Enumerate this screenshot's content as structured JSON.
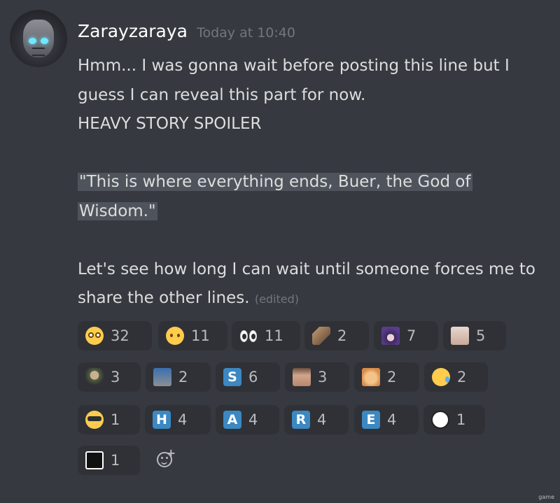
{
  "message": {
    "username": "Zarayzaraya",
    "timestamp": "Today at 10:40",
    "lines": [
      "Hmm... I was gonna wait before posting this line but I guess I can reveal this part for now.",
      "HEAVY STORY SPOILER"
    ],
    "spoiler": "\"This is where everything ends, Buer, the God of Wisdom.\"",
    "closing": "Let's see how long I can wait until someone forces me to share the other lines.",
    "edited": "(edited)"
  },
  "reactions": [
    {
      "icon": "flushed-face-icon",
      "count": "32"
    },
    {
      "icon": "face-with-raised-eyebrow-icon",
      "count": "11"
    },
    {
      "icon": "eyes-icon",
      "count": "11"
    },
    {
      "icon": "otter-emote-icon",
      "count": "2"
    },
    {
      "icon": "anime-girl-emote-icon",
      "count": "7"
    },
    {
      "icon": "anime-face-emote-icon",
      "count": "5"
    },
    {
      "icon": "soldier-emote-icon",
      "count": "3"
    },
    {
      "icon": "knight-emote-icon",
      "count": "2"
    },
    {
      "icon": "regional-indicator-s-icon",
      "letter": "S",
      "count": "6"
    },
    {
      "icon": "man-face-emote-icon",
      "count": "3"
    },
    {
      "icon": "cat-girl-emote-icon",
      "count": "2"
    },
    {
      "icon": "sad-but-relieved-face-icon",
      "count": "2"
    },
    {
      "icon": "smiling-face-with-sunglasses-icon",
      "count": "1"
    },
    {
      "icon": "regional-indicator-h-icon",
      "letter": "H",
      "count": "4"
    },
    {
      "icon": "regional-indicator-a-icon",
      "letter": "A",
      "count": "4"
    },
    {
      "icon": "regional-indicator-r-icon",
      "letter": "R",
      "count": "4"
    },
    {
      "icon": "regional-indicator-e-icon",
      "letter": "E",
      "count": "4"
    },
    {
      "icon": "troll-face-emote-icon",
      "count": "1"
    },
    {
      "icon": "troll-face-dark-emote-icon",
      "count": "1"
    }
  ],
  "add_reaction_icon": "add-reaction-icon",
  "watermark": "game",
  "colors": {
    "background": "#36393f",
    "reaction_bg": "#2f3136",
    "spoiler_bg": "#4f545c",
    "letter_blue": "#3b88c3"
  }
}
